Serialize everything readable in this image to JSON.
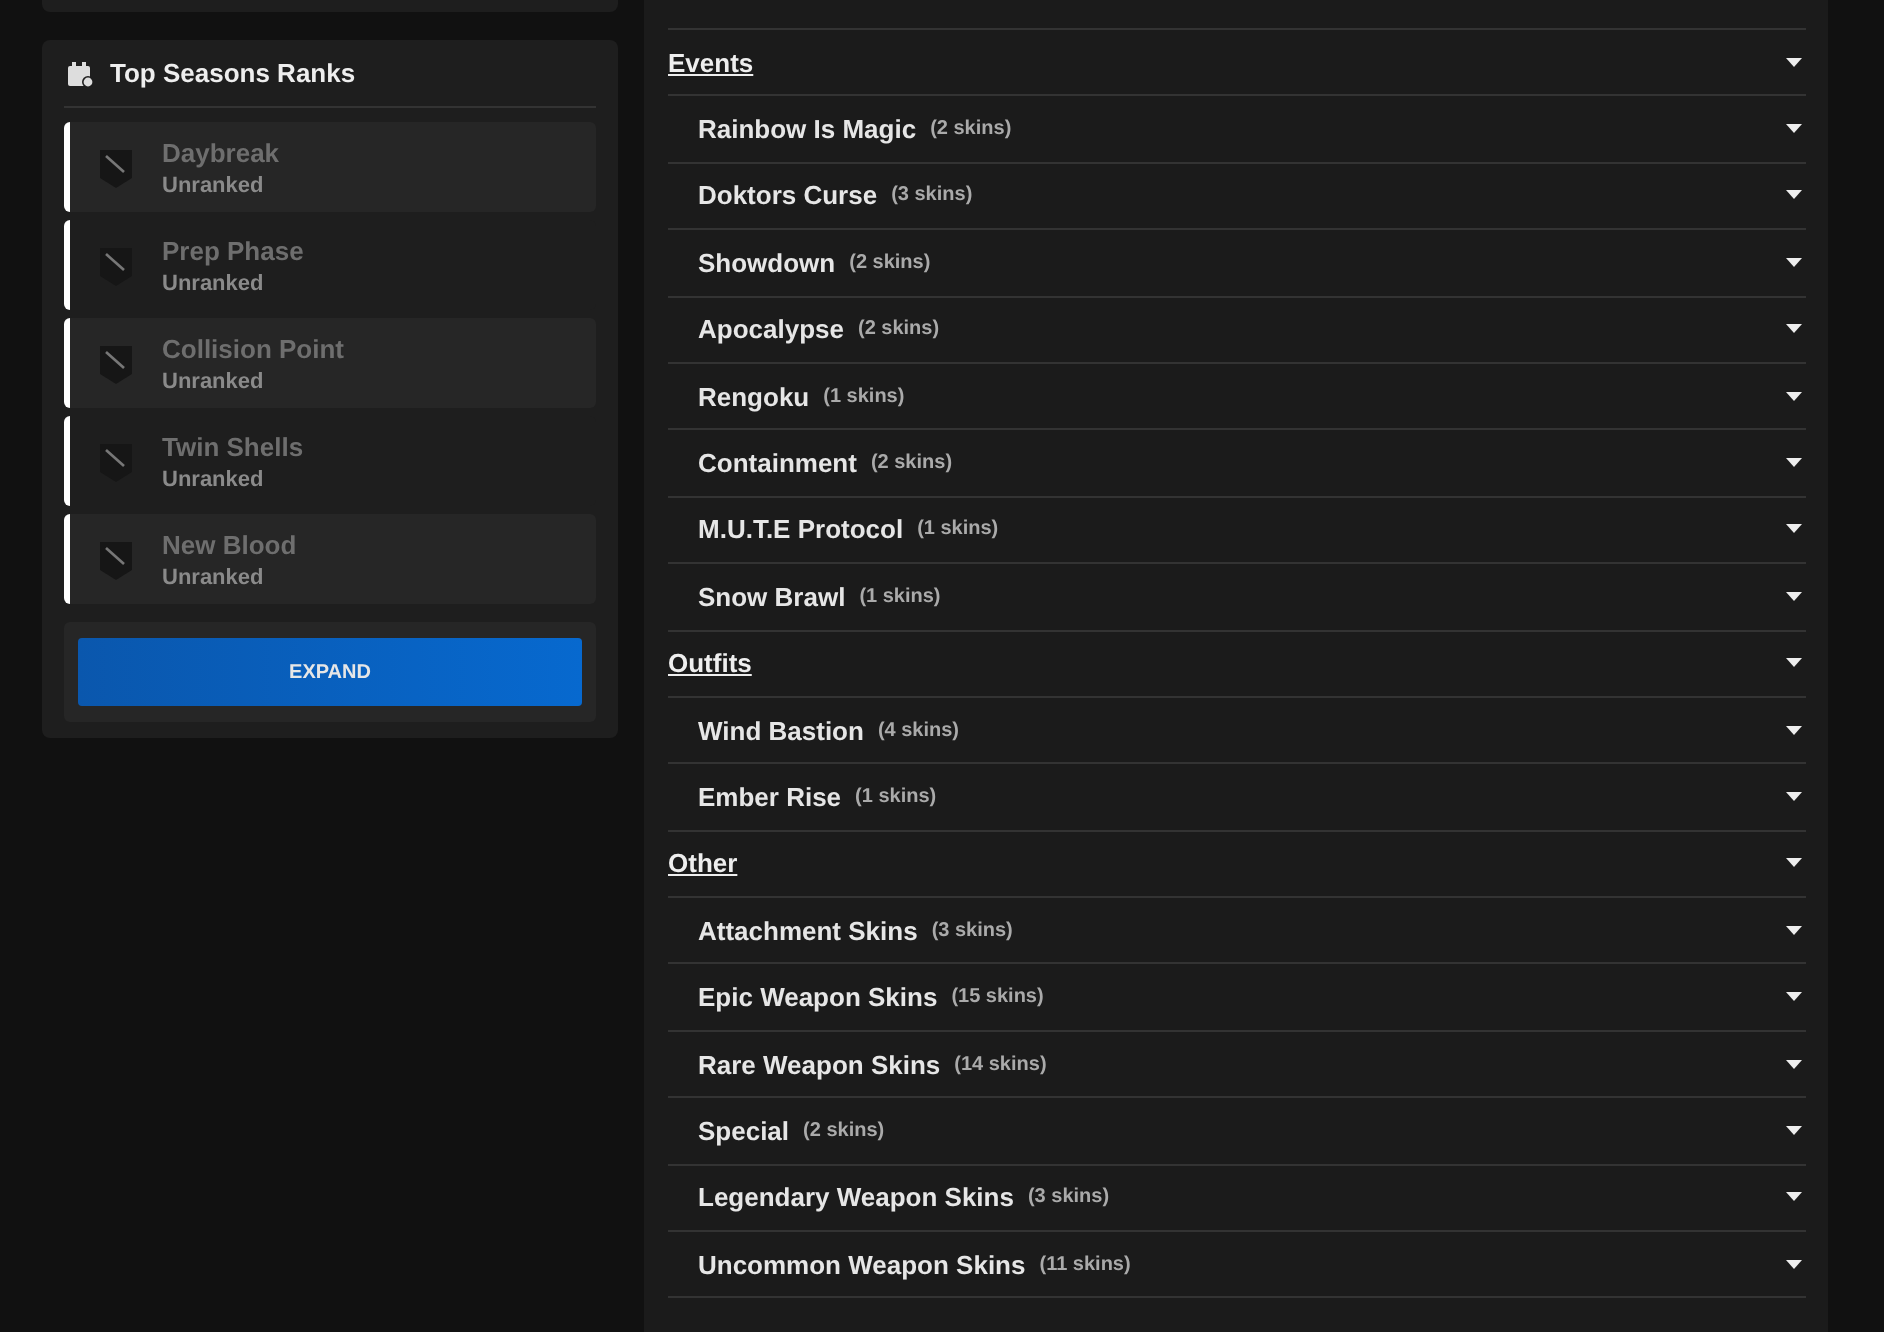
{
  "ranks_card": {
    "title": "Top Seasons Ranks",
    "seasons": [
      {
        "name": "Daybreak",
        "rank": "Unranked"
      },
      {
        "name": "Prep Phase",
        "rank": "Unranked"
      },
      {
        "name": "Collision Point",
        "rank": "Unranked"
      },
      {
        "name": "Twin Shells",
        "rank": "Unranked"
      },
      {
        "name": "New Blood",
        "rank": "Unranked"
      }
    ],
    "expand_button": "EXPAND"
  },
  "skin_list": [
    {
      "kind": "group",
      "name": "Events"
    },
    {
      "kind": "item",
      "name": "Rainbow Is Magic",
      "count": "(2 skins)"
    },
    {
      "kind": "item",
      "name": "Doktors Curse",
      "count": "(3 skins)"
    },
    {
      "kind": "item",
      "name": "Showdown",
      "count": "(2 skins)"
    },
    {
      "kind": "item",
      "name": "Apocalypse",
      "count": "(2 skins)"
    },
    {
      "kind": "item",
      "name": "Rengoku",
      "count": "(1 skins)"
    },
    {
      "kind": "item",
      "name": "Containment",
      "count": "(2 skins)"
    },
    {
      "kind": "item",
      "name": "M.U.T.E Protocol",
      "count": "(1 skins)"
    },
    {
      "kind": "item",
      "name": "Snow Brawl",
      "count": "(1 skins)"
    },
    {
      "kind": "group",
      "name": "Outfits"
    },
    {
      "kind": "item",
      "name": "Wind Bastion",
      "count": "(4 skins)"
    },
    {
      "kind": "item",
      "name": "Ember Rise",
      "count": "(1 skins)"
    },
    {
      "kind": "group",
      "name": "Other"
    },
    {
      "kind": "item",
      "name": "Attachment Skins",
      "count": "(3 skins)"
    },
    {
      "kind": "item",
      "name": "Epic Weapon Skins",
      "count": "(15 skins)"
    },
    {
      "kind": "item",
      "name": "Rare Weapon Skins",
      "count": "(14 skins)"
    },
    {
      "kind": "item",
      "name": "Special",
      "count": "(2 skins)"
    },
    {
      "kind": "item",
      "name": "Legendary Weapon Skins",
      "count": "(3 skins)"
    },
    {
      "kind": "item",
      "name": "Uncommon Weapon Skins",
      "count": "(11 skins)"
    }
  ]
}
